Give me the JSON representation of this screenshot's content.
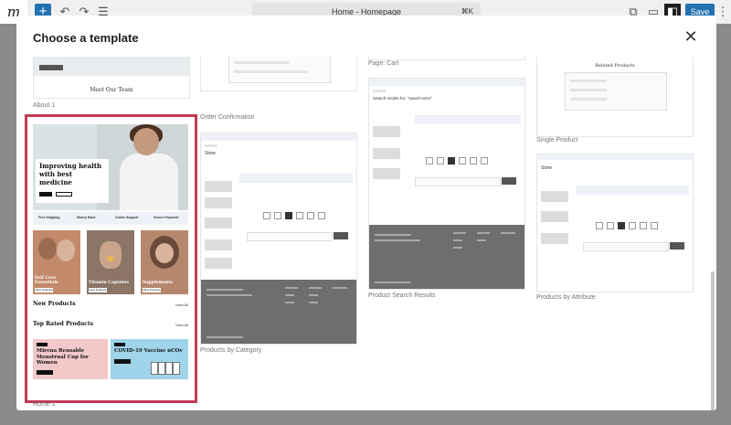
{
  "editor": {
    "logo_glyph": "m",
    "add_glyph": "+",
    "undo_glyph": "↶",
    "redo_glyph": "↷",
    "list_view_glyph": "☰",
    "document_title": "Home - Homepage",
    "shortcut": "⌘K",
    "view_glyph": "⧉",
    "preview_glyph": "▭",
    "sidebar_glyph": "◧",
    "save_label": "Save",
    "more_glyph": "⋮"
  },
  "modal": {
    "title": "Choose a template",
    "close_glyph": "✕"
  },
  "templates": {
    "about": {
      "label": "About 1",
      "team_heading": "Meet Our Team"
    },
    "order_confirmation": {
      "label": "Order Confirmation"
    },
    "cart": {
      "label": "Page: Cart"
    },
    "single_product": {
      "label": "Single Product",
      "related_heading": "Related Products"
    },
    "home": {
      "label": "Home 1",
      "selected": true,
      "hero_heading": "Improving health with best medicine",
      "features": [
        {
          "title": "Free Shipping"
        },
        {
          "title": "Money Back"
        },
        {
          "title": "Online Support"
        },
        {
          "title": "Secure Payment"
        }
      ],
      "categories": [
        {
          "label": "Self Care Essentials"
        },
        {
          "label": "Vitamin Capsules"
        },
        {
          "label": "Supplements"
        }
      ],
      "category_button": "View Products",
      "new_products_heading": "New Products",
      "top_rated_heading": "Top Rated Products",
      "view_all": "View All",
      "promos": [
        {
          "tag": "SALE",
          "heading": "Mirena Reusable Menstrual Cup for Women",
          "button": "Shop Now"
        },
        {
          "tag": "SALE",
          "heading": "COVID-19 Vaccine nCOv",
          "button": "Shop Now"
        }
      ]
    },
    "products_by_category": {
      "label": "Products by Category",
      "header_text": "Store"
    },
    "product_search_results": {
      "label": "Product Search Results",
      "search_heading": "Search results for: \"search term\""
    },
    "products_by_attribute": {
      "label": "Products by Attribute",
      "header_text": "Store"
    }
  },
  "colors": {
    "accent_blue": "#2271b1",
    "selection_red": "#c23a52",
    "footer_gray": "#6e6e6e"
  }
}
